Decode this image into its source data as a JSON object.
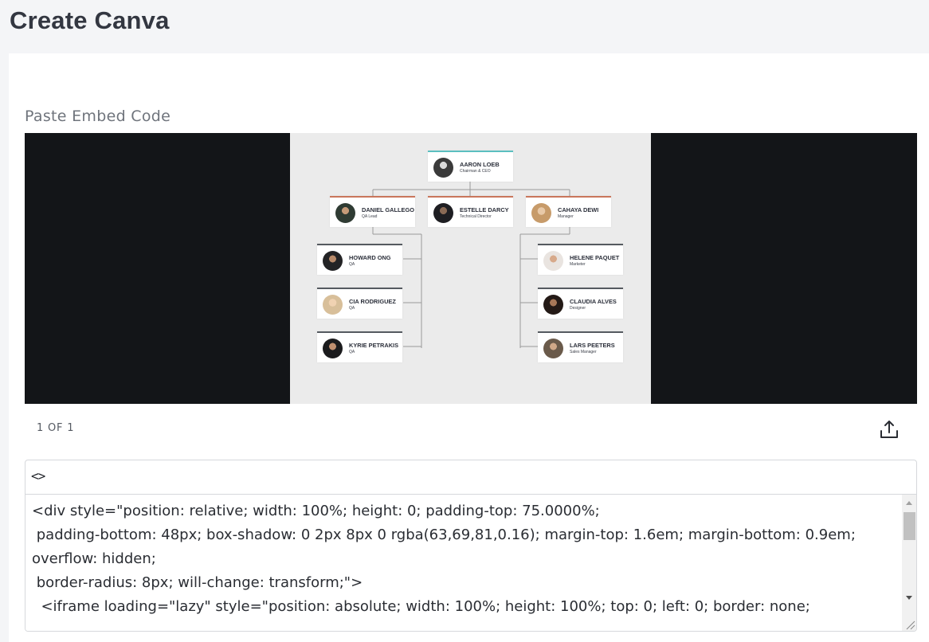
{
  "page": {
    "title": "Create Canva"
  },
  "form": {
    "field_label": "Paste Embed Code"
  },
  "preview": {
    "pager": "1 OF 1",
    "org_chart": {
      "ceo": {
        "name": "AARON LOEB",
        "role": "Chairman & CEO",
        "accent": "#5bbfc0"
      },
      "level2": [
        {
          "name": "DANIEL GALLEGO",
          "role": "QA Lead",
          "accent": "#c9765c"
        },
        {
          "name": "ESTELLE DARCY",
          "role": "Technical Director",
          "accent": "#c9765c"
        },
        {
          "name": "CAHAYA DEWI",
          "role": "Manager",
          "accent": "#c9765c"
        }
      ],
      "left_reports": [
        {
          "name": "HOWARD ONG",
          "role": "QA",
          "accent": "#555a60"
        },
        {
          "name": "CIA RODRIGUEZ",
          "role": "QA",
          "accent": "#555a60"
        },
        {
          "name": "KYRIE PETRAKIS",
          "role": "QA",
          "accent": "#555a60"
        }
      ],
      "right_reports": [
        {
          "name": "HELENE PAQUET",
          "role": "Marketer",
          "accent": "#555a60"
        },
        {
          "name": "CLAUDIA ALVES",
          "role": "Designer",
          "accent": "#555a60"
        },
        {
          "name": "LARS PEETERS",
          "role": "Sales Manager",
          "accent": "#555a60"
        }
      ]
    }
  },
  "embed": {
    "toggle_icon": "code-brackets-icon",
    "code": "<div style=\"position: relative; width: 100%; height: 0; padding-top: 75.0000%;\n padding-bottom: 48px; box-shadow: 0 2px 8px 0 rgba(63,69,81,0.16); margin-top: 1.6em; margin-bottom: 0.9em; overflow: hidden;\n border-radius: 8px; will-change: transform;\">\n  <iframe loading=\"lazy\" style=\"position: absolute; width: 100%; height: 100%; top: 0; left: 0; border: none;"
  },
  "icons": {
    "share": "share-upload-icon"
  },
  "colors": {
    "preview_bg": "#131518",
    "design_bg": "#ebebeb",
    "card_bg": "#ffffff"
  }
}
